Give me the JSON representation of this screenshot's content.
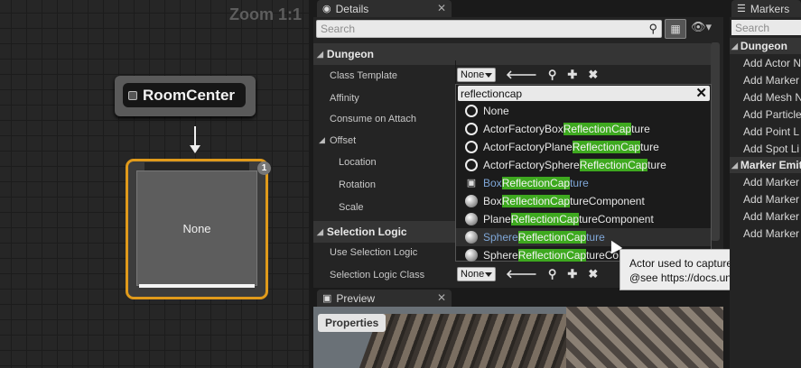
{
  "graph": {
    "zoom_label": "Zoom 1:1",
    "room_node_label": "RoomCenter",
    "none_node_label": "None",
    "badge_count": "1"
  },
  "tabs": {
    "details": "Details",
    "preview": "Preview",
    "markers": "Markers"
  },
  "details": {
    "search_placeholder": "Search",
    "category_dungeon": "Dungeon",
    "class_template_label": "Class Template",
    "affinity_label": "Affinity",
    "consume_label": "Consume on Attach",
    "offset_label": "Offset",
    "location_label": "Location",
    "rotation_label": "Rotation",
    "scale_label": "Scale",
    "category_selection": "Selection Logic",
    "use_selection_label": "Use Selection Logic",
    "selection_class_label": "Selection Logic Class",
    "combo_value": "None",
    "combo_value_2": "None"
  },
  "dropdown": {
    "query": "reflectioncap",
    "items": [
      {
        "pre": "None",
        "hl": "",
        "post": "",
        "icon": "ring-icon"
      },
      {
        "pre": "ActorFactoryBox",
        "hl": "ReflectionCap",
        "post": "ture",
        "icon": "ring-icon"
      },
      {
        "pre": "ActorFactoryPlane",
        "hl": "ReflectionCap",
        "post": "ture",
        "icon": "ring-icon"
      },
      {
        "pre": "ActorFactorySphere",
        "hl": "ReflectionCap",
        "post": "ture",
        "icon": "ring-icon"
      },
      {
        "pre": "Box",
        "hl": "ReflectionCap",
        "post": "ture",
        "icon": "camera-icon"
      },
      {
        "pre": "Box",
        "hl": "ReflectionCap",
        "post": "tureComponent",
        "icon": "sphere-icon"
      },
      {
        "pre": "Plane",
        "hl": "ReflectionCap",
        "post": "tureComponent",
        "icon": "sphere-icon"
      },
      {
        "pre": "Sphere",
        "hl": "ReflectionCap",
        "post": "ture",
        "icon": "sphere-icon"
      },
      {
        "pre": "Sphere",
        "hl": "ReflectionCap",
        "post": "tureCo",
        "icon": "sphere-icon"
      }
    ]
  },
  "tooltip": {
    "line1": "Actor used to capture the scene for",
    "line2": "@see https://docs.unrealengine.con"
  },
  "preview": {
    "properties_label": "Properties"
  },
  "markers": {
    "search_placeholder": "Search",
    "cat1": "Dungeon",
    "items1": [
      "Add Actor N",
      "Add Marker",
      "Add Mesh N",
      "Add Particle",
      "Add Point L",
      "Add Spot Li"
    ],
    "cat2": "Marker Emitte",
    "items2": [
      "Add Marker",
      "Add Marker",
      "Add Marker",
      "Add Marker"
    ]
  }
}
